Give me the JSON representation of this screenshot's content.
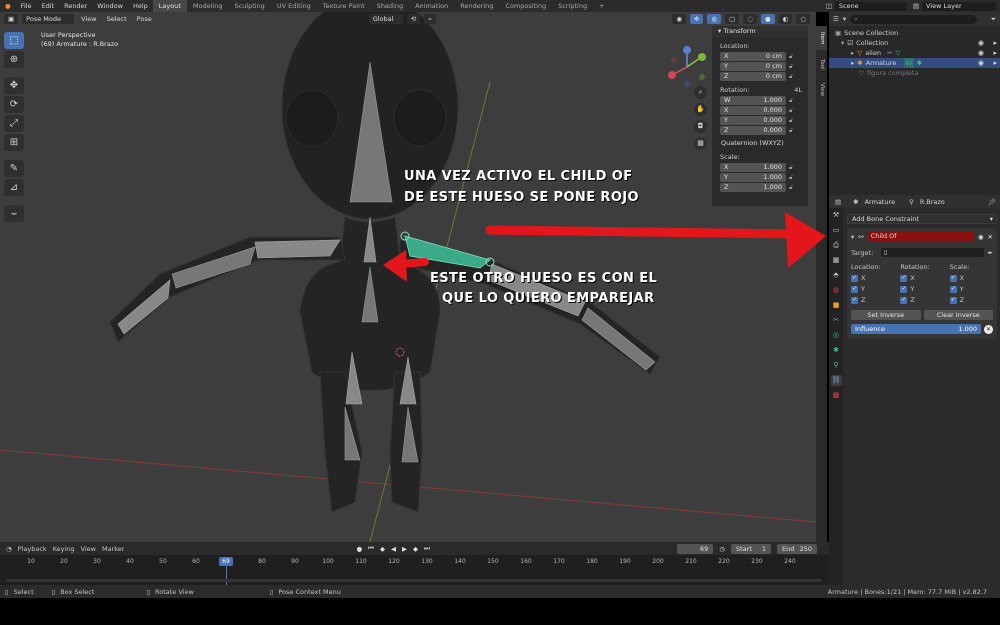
{
  "topbar": {
    "menus": [
      "File",
      "Edit",
      "Render",
      "Window",
      "Help"
    ],
    "workspaces": [
      "Layout",
      "Modeling",
      "Sculpting",
      "UV Editing",
      "Texture Paint",
      "Shading",
      "Animation",
      "Rendering",
      "Compositing",
      "Scripting"
    ],
    "active_workspace": "Layout",
    "add_workspace": "+",
    "scene": "Scene",
    "view_layer": "View Layer"
  },
  "viewport": {
    "mode": "Pose Mode",
    "menus": [
      "View",
      "Select",
      "Pose"
    ],
    "orientation": "Global",
    "perspective": "User Perspective",
    "active_info": "(69) Armature : R.Brazo"
  },
  "npanel": {
    "header": "Transform",
    "location_label": "Location:",
    "location": [
      {
        "axis": "X",
        "value": "0 cm"
      },
      {
        "axis": "Y",
        "value": "0 cm"
      },
      {
        "axis": "Z",
        "value": "0 cm"
      }
    ],
    "rotation_label": "Rotation:",
    "rotation_mode_short": "4L",
    "rotation": [
      {
        "axis": "W",
        "value": "1.000"
      },
      {
        "axis": "X",
        "value": "0.000"
      },
      {
        "axis": "Y",
        "value": "0.000"
      },
      {
        "axis": "Z",
        "value": "0.000"
      }
    ],
    "rotation_mode": "Quaternion (WXYZ)",
    "scale_label": "Scale:",
    "scale": [
      {
        "axis": "X",
        "value": "1.000"
      },
      {
        "axis": "Y",
        "value": "1.000"
      },
      {
        "axis": "Z",
        "value": "1.000"
      }
    ],
    "tabs": [
      "Item",
      "Tool",
      "View"
    ]
  },
  "outliner": {
    "items": [
      {
        "label": "Scene Collection",
        "indent": 0
      },
      {
        "label": "Collection",
        "indent": 1
      },
      {
        "label": "alien",
        "indent": 2
      },
      {
        "label": "Armature",
        "indent": 2,
        "selected": true
      },
      {
        "label": "figura completa",
        "indent": 1,
        "dim": true
      }
    ]
  },
  "properties": {
    "breadcrumb_object": "Armature",
    "breadcrumb_bone": "R.Brazo",
    "add_constraint": "Add Bone Constraint",
    "constraint_name": "Child Of",
    "target_label": "Target:",
    "location_label": "Location:",
    "rotation_label": "Rotation:",
    "scale_label": "Scale:",
    "axes": [
      "X",
      "Y",
      "Z"
    ],
    "set_inverse": "Set Inverse",
    "clear_inverse": "Clear Inverse",
    "influence_label": "Influence",
    "influence_value": "1.000",
    "influence": 1.0
  },
  "timeline": {
    "menus": [
      "Playback",
      "Keying",
      "View",
      "Marker"
    ],
    "current_frame": "69",
    "start_label": "Start",
    "start": "1",
    "end_label": "End",
    "end": "250",
    "ticks": [
      "10",
      "20",
      "30",
      "40",
      "50",
      "60",
      "80",
      "90",
      "100",
      "110",
      "120",
      "130",
      "140",
      "150",
      "160",
      "170",
      "180",
      "190",
      "200",
      "210",
      "220",
      "230",
      "240"
    ]
  },
  "statusbar": {
    "select": "Select",
    "box_select": "Box Select",
    "rotate_view": "Rotate View",
    "context_menu": "Pose Context Menu",
    "stats": "Armature | Bones:1/21 | Mem: 77.7 MiB | v2.82.7"
  },
  "annotations": {
    "top_line1": "UNA VEZ ACTIVO EL CHILD OF",
    "top_line2": "DE ESTE HUESO SE PONE ROJO",
    "bottom_line1": "ESTE OTRO HUESO ES CON EL",
    "bottom_line2": "QUE LO QUIERO EMPAREJAR"
  },
  "colors": {
    "accent_blue": "#4772b3",
    "constraint_red": "#8b1010",
    "annotation_arrow": "#e3161c",
    "selected_bone": "#3aaa88"
  }
}
